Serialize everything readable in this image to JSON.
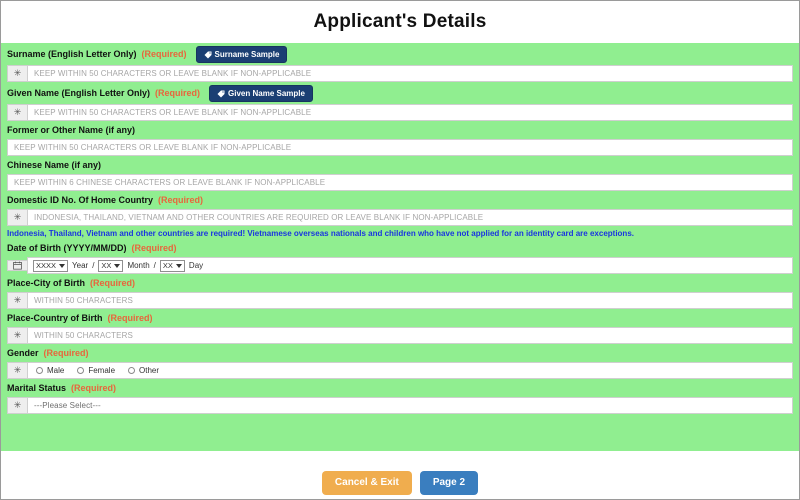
{
  "header": {
    "title": "Applicant's Details"
  },
  "colors": {
    "panel_green": "#90ee90",
    "required_red": "#e8663c",
    "note_blue": "#1a35e0",
    "sample_button": "#1b3f73",
    "cancel_button": "#f0ad4e",
    "next_button": "#3a7ebf"
  },
  "labels": {
    "required": "(Required)",
    "asterisk": "✳",
    "slash": "/"
  },
  "fields": {
    "surname": {
      "label": "Surname (English Letter Only)",
      "required": "(Required)",
      "sample_button": "Surname Sample",
      "placeholder": "KEEP WITHIN 50 CHARACTERS OR LEAVE BLANK IF NON-APPLICABLE",
      "value": ""
    },
    "given_name": {
      "label": "Given Name (English Letter Only)",
      "required": "(Required)",
      "sample_button": "Given Name Sample",
      "placeholder": "KEEP WITHIN 50 CHARACTERS OR LEAVE BLANK IF NON-APPLICABLE",
      "value": ""
    },
    "former_name": {
      "label": "Former or Other Name (if any)",
      "placeholder": "KEEP WITHIN 50 CHARACTERS OR LEAVE BLANK IF NON-APPLICABLE",
      "value": ""
    },
    "chinese_name": {
      "label": "Chinese Name (if any)",
      "placeholder": "KEEP WITHIN 6 CHINESE CHARACTERS OR LEAVE BLANK IF NON-APPLICABLE",
      "value": ""
    },
    "domestic_id": {
      "label": "Domestic ID No. Of Home Country",
      "required": "(Required)",
      "placeholder": "INDONESIA, THAILAND, VIETNAM AND OTHER COUNTRIES ARE REQUIRED OR LEAVE BLANK IF NON-APPLICABLE",
      "value": "",
      "note": "Indonesia, Thailand, Vietnam and other countries are required! Vietnamese overseas nationals and children who have not applied for an identity card are exceptions."
    },
    "date_of_birth": {
      "label": "Date of Birth (YYYY/MM/DD)",
      "required": "(Required)",
      "year_value": "XXXX",
      "year_unit": "Year",
      "month_value": "XX",
      "month_unit": "Month",
      "day_value": "XX",
      "day_unit": "Day"
    },
    "city_of_birth": {
      "label": "Place-City of Birth",
      "required": "(Required)",
      "placeholder": "WITHIN 50 CHARACTERS",
      "value": ""
    },
    "country_of_birth": {
      "label": "Place-Country of Birth",
      "required": "(Required)",
      "placeholder": "WITHIN 50 CHARACTERS",
      "value": ""
    },
    "gender": {
      "label": "Gender",
      "required": "(Required)",
      "options": [
        "Male",
        "Female",
        "Other"
      ],
      "selected": ""
    },
    "marital_status": {
      "label": "Marital Status",
      "required": "(Required)",
      "selected": "---Please Select---"
    }
  },
  "footer": {
    "cancel_label": "Cancel & Exit",
    "next_label": "Page 2"
  }
}
